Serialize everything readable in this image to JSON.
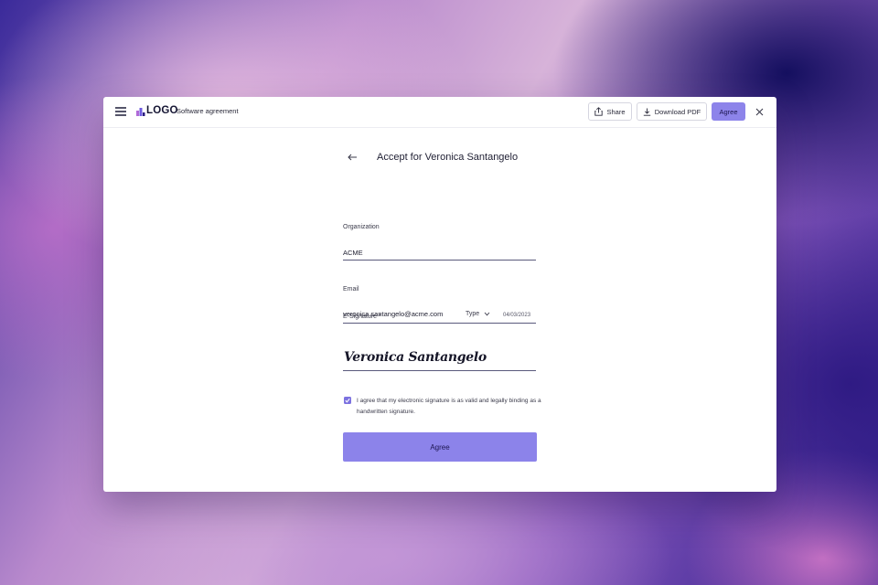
{
  "app": {
    "logo": "LOGO",
    "document_title": "Software agreement"
  },
  "toolbar": {
    "share_label": "Share",
    "download_label": "Download PDF",
    "agree_label": "Agree"
  },
  "form": {
    "title": "Accept for Veronica Santangelo",
    "organization": {
      "label": "Organization",
      "value": "ACME"
    },
    "email": {
      "label": "Email",
      "value": "veronica.santangelo@acme.com"
    },
    "signature": {
      "label": "E-Signature *",
      "type_label": "Type",
      "date": "04/03/2023",
      "value": "Veronica Santangelo"
    },
    "consent_text": "I agree that my electronic signature is as valid and legally binding as a handwritten signature.",
    "consent_checked": true,
    "submit_label": "Agree"
  },
  "colors": {
    "accent": "#8c83ea",
    "accent_text": "#1c1650",
    "checkbox": "#7c72e0"
  },
  "icons": {
    "menu": "hamburger-icon",
    "share": "share-icon",
    "download": "download-icon",
    "close": "close-icon",
    "back": "arrow-left-icon",
    "select": "chevron-down-icon",
    "check": "check-icon"
  }
}
